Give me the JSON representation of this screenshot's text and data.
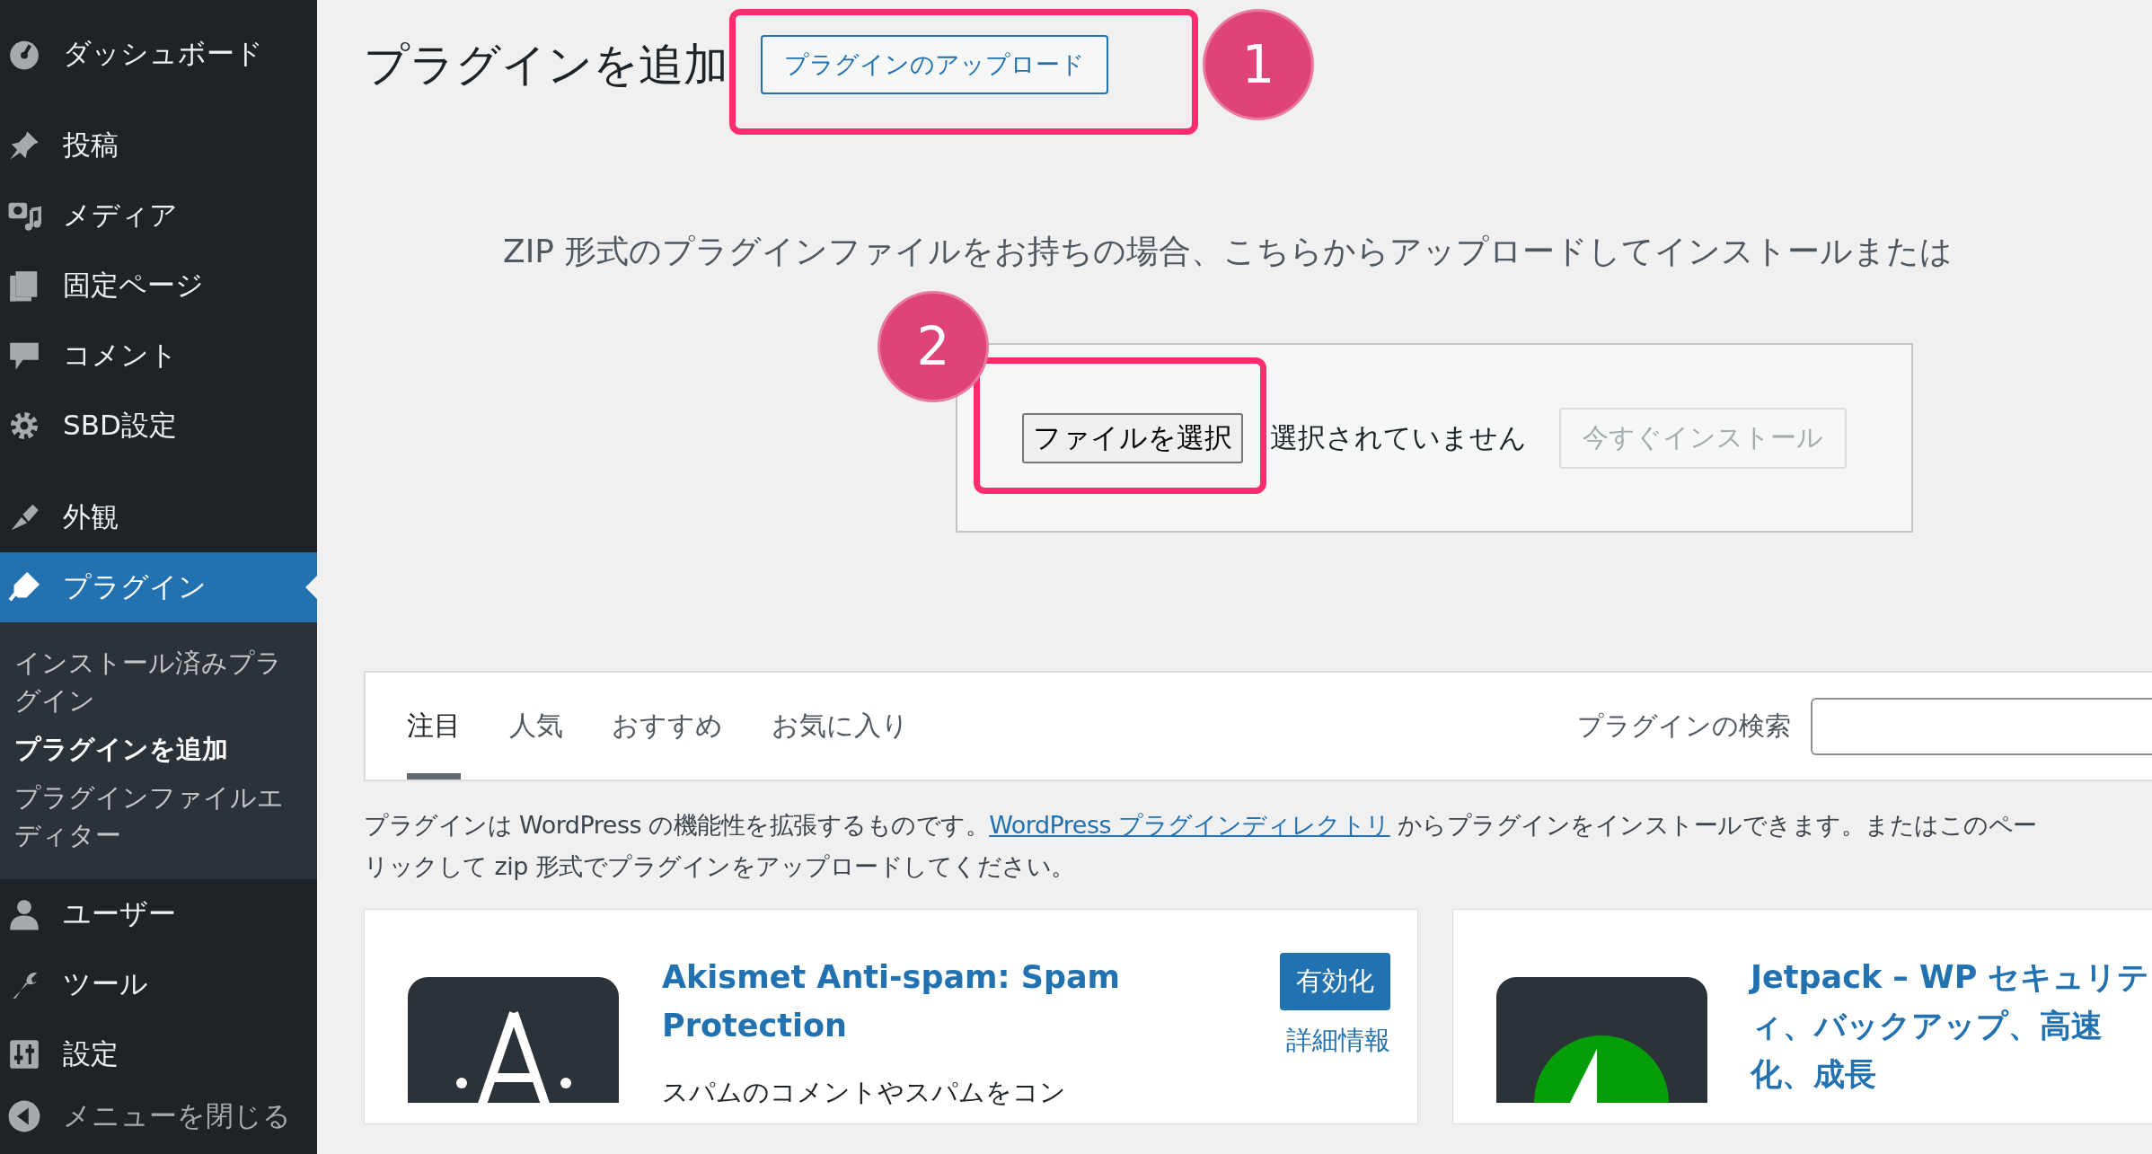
{
  "sidebar": {
    "items": [
      {
        "label": "ダッシュボード",
        "kind": "menu",
        "selected": false
      },
      {
        "label": "投稿",
        "kind": "menu",
        "selected": false
      },
      {
        "label": "メディア",
        "kind": "menu",
        "selected": false
      },
      {
        "label": "固定ページ",
        "kind": "menu",
        "selected": false
      },
      {
        "label": "コメント",
        "kind": "menu",
        "selected": false
      },
      {
        "label": "SBD設定",
        "kind": "menu",
        "selected": false
      },
      {
        "label": "外観",
        "kind": "menu",
        "selected": false
      },
      {
        "label": "プラグイン",
        "kind": "menu",
        "selected": true,
        "children": [
          {
            "label": "インストール済みプラグイン",
            "selected": false
          },
          {
            "label": "プラグインを追加",
            "selected": true
          },
          {
            "label": "プラグインファイルエディター",
            "selected": false
          }
        ]
      },
      {
        "label": "ユーザー",
        "kind": "menu",
        "selected": false
      },
      {
        "label": "ツール",
        "kind": "menu",
        "selected": false
      },
      {
        "label": "設定",
        "kind": "menu",
        "selected": false
      },
      {
        "label": "メニューを閉じる",
        "kind": "collapse",
        "selected": false
      }
    ]
  },
  "page": {
    "title": "プラグインを追加",
    "upload_button": "プラグインのアップロード"
  },
  "upload": {
    "description": "ZIP 形式のプラグインファイルをお持ちの場合、こちらからアップロードしてインストールまたは",
    "file_button": "ファイルを選択",
    "file_status": "選択されていません",
    "install_button": "今すぐインストール",
    "install_disabled": true
  },
  "tabs": [
    {
      "label": "注目",
      "selected": true
    },
    {
      "label": "人気",
      "selected": false
    },
    {
      "label": "おすすめ",
      "selected": false
    },
    {
      "label": "お気に入り",
      "selected": false
    }
  ],
  "search": {
    "label": "プラグインの検索"
  },
  "intro": {
    "before": "プラグインは WordPress の機能性を拡張するものです。",
    "link": "WordPress プラグインディレクトリ",
    "after": " からプラグインをインストールできます。またはこのペー",
    "second_line": "リックして zip 形式でプラグインをアップロードしてください。"
  },
  "cards": [
    {
      "kind": "akismet",
      "title": "Akismet Anti-spam: Spam Protection",
      "action": "有効化",
      "details": "詳細情報",
      "description": "スパムのコメントやスパムをコン"
    },
    {
      "kind": "jetpack",
      "title": "Jetpack – WP セキュリティ、バックアップ、高速化、成長"
    }
  ],
  "annotations": [
    {
      "label": "1"
    },
    {
      "label": "2"
    }
  ]
}
